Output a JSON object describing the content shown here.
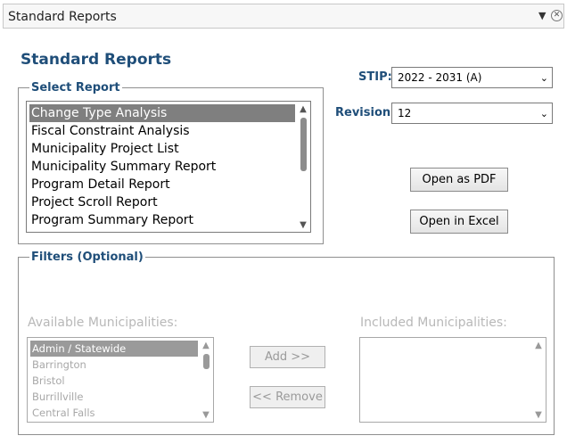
{
  "window": {
    "title": "Standard Reports",
    "dropdown_icon": "dropdown-arrow-icon",
    "close_icon": "close-circle-icon"
  },
  "page": {
    "heading": "Standard Reports"
  },
  "select_report": {
    "legend": "Select Report",
    "items": [
      "Change Type Analysis",
      "Fiscal Constraint Analysis",
      "Municipality Project List",
      "Municipality Summary Report",
      "Program Detail Report",
      "Project Scroll Report",
      "Program Summary Report"
    ],
    "selected": "Change Type Analysis"
  },
  "stip": {
    "label": "STIP:",
    "value": "2022 - 2031 (A)"
  },
  "revision": {
    "label": "Revision:",
    "value": "12"
  },
  "actions": {
    "open_pdf": "Open as PDF",
    "open_excel": "Open in Excel"
  },
  "filters": {
    "legend": "Filters (Optional)",
    "available_label": "Available Municipalities:",
    "included_label": "Included Municipalities:",
    "available": [
      "Admin / Statewide",
      "Barrington",
      "Bristol",
      "Burrillville",
      "Central Falls"
    ],
    "available_selected": "Admin / Statewide",
    "included": [],
    "add_label": "Add >>",
    "remove_label": "<< Remove"
  },
  "colors": {
    "accent": "#1f4e79",
    "selected_bg": "#7f7f7f",
    "disabled_text": "#b8b8b8"
  }
}
